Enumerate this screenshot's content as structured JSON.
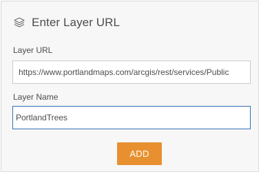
{
  "header": {
    "icon": "layers-icon",
    "title": "Enter Layer URL"
  },
  "form": {
    "url_label": "Layer URL",
    "url_value": "https://www.portlandmaps.com/arcgis/rest/services/Public",
    "name_label": "Layer Name",
    "name_value": "PortlandTrees",
    "add_label": "ADD"
  },
  "colors": {
    "accent": "#e8902f",
    "focus_border": "#2e6fb5",
    "panel_background": "#f7f7f7",
    "text": "#4c4c4c"
  }
}
